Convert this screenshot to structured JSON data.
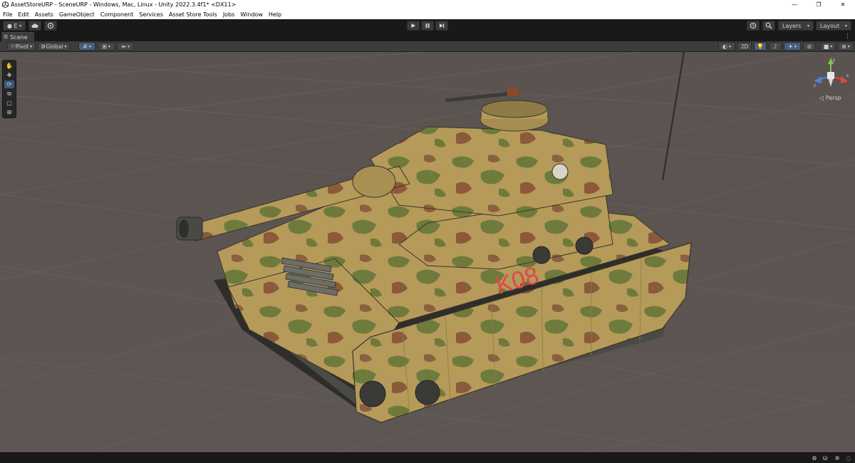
{
  "window": {
    "title": "AssetStoreURP - SceneURP - Windows, Mac, Linux - Unity 2022.3.4f1* <DX11>",
    "controls": {
      "minimize": "—",
      "maximize": "❐",
      "close": "✕"
    }
  },
  "menu": [
    "File",
    "Edit",
    "Assets",
    "GameObject",
    "Component",
    "Services",
    "Asset Store Tools",
    "Jobs",
    "Window",
    "Help"
  ],
  "toolbar": {
    "account_label": "E",
    "cloud_icon": "cloud-icon",
    "collab_icon": "collab-icon",
    "play_icon": "play-icon",
    "pause_icon": "pause-icon",
    "step_icon": "step-icon",
    "history_icon": "history-icon",
    "search_icon": "search-icon",
    "layers_label": "Layers",
    "layout_label": "Layout"
  },
  "scene_tab": {
    "label": "Scene"
  },
  "scene_toolbar": {
    "pivot_label": "Pivot",
    "global_label": "Global",
    "mode_2d_label": "2D"
  },
  "gizmo": {
    "projection_label": "Persp",
    "axis_labels": {
      "y": "y",
      "x": "x",
      "z": "z"
    }
  },
  "tank": {
    "marking": "K08",
    "marking_color": "#e04848"
  },
  "colors": {
    "editor_dark": "#191919",
    "panel": "#3c3c3c",
    "ground": "#5b5451",
    "grid_line": "#6b6460",
    "accent_selected": "#3b5a7a"
  }
}
